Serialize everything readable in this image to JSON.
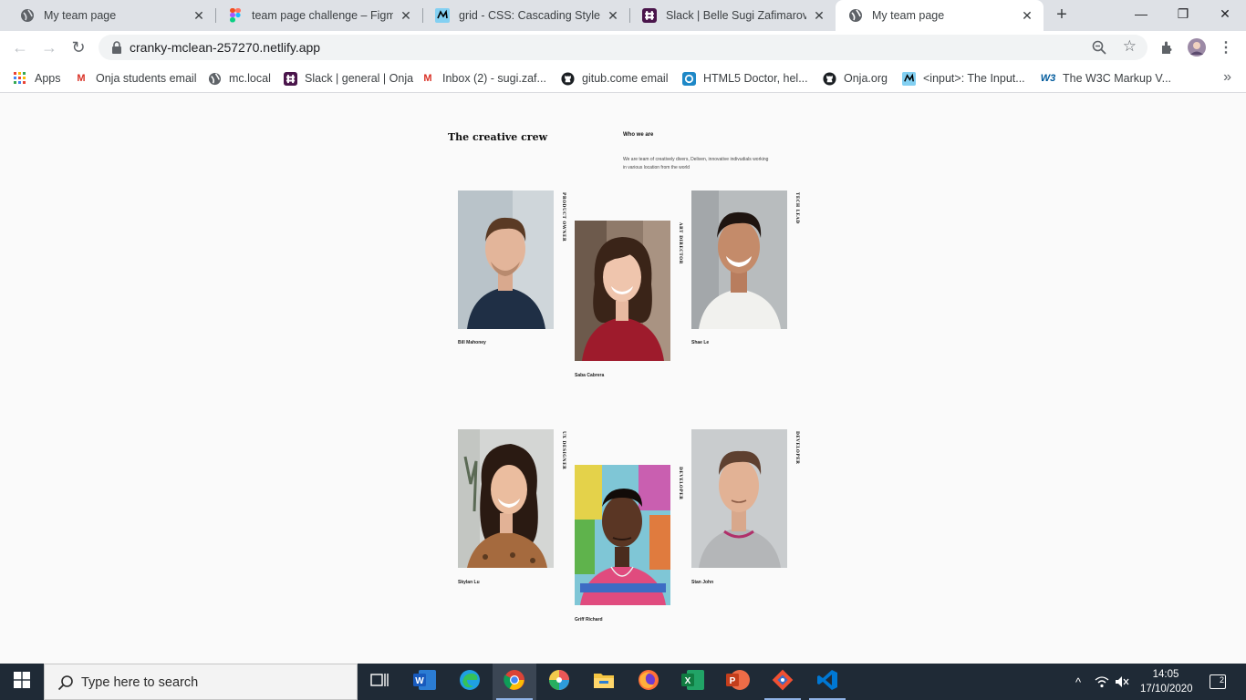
{
  "browser": {
    "tabs": [
      {
        "title": "My team page",
        "icon": "globe-icon",
        "active": false
      },
      {
        "title": "team page challenge – Figma",
        "icon": "figma-icon",
        "active": false
      },
      {
        "title": "grid - CSS: Cascading Style She",
        "icon": "mdn-icon",
        "active": false
      },
      {
        "title": "Slack | Belle Sugi Zafimarovolo",
        "icon": "slack-icon",
        "active": false
      },
      {
        "title": "My team page",
        "icon": "globe-icon",
        "active": true
      }
    ],
    "new_tab": "+",
    "window_controls": {
      "minimize": "—",
      "maximize": "❐",
      "close": "✕"
    },
    "url": "cranky-mclean-257270.netlify.app",
    "bookmarks": [
      {
        "label": "Apps",
        "icon": "apps-grid-icon"
      },
      {
        "label": "Onja students email",
        "icon": "gmail-icon"
      },
      {
        "label": "mc.local",
        "icon": "globe-icon"
      },
      {
        "label": "Slack | general | Onja",
        "icon": "slack-icon"
      },
      {
        "label": "Inbox (2) - sugi.zaf...",
        "icon": "gmail-icon"
      },
      {
        "label": "gitub.come email",
        "icon": "github-icon"
      },
      {
        "label": "HTML5 Doctor, hel...",
        "icon": "html5doctor-icon"
      },
      {
        "label": "Onja.org",
        "icon": "github-icon"
      },
      {
        "label": "<input>: The Input...",
        "icon": "mdn-icon"
      },
      {
        "label": "The W3C Markup V...",
        "icon": "w3c-icon"
      }
    ],
    "bookmarks_more": "»"
  },
  "page": {
    "title": "The creative crew",
    "who_title": "Who we are",
    "who_text": "We are team of creatively divers, Deliven, innovative indivudials working in various location from the world",
    "members": [
      {
        "name": "Bill Mahoney",
        "role": "PRODUCT OWNER"
      },
      {
        "name": "Saba Cabrera",
        "role": "ART DIRECTOR"
      },
      {
        "name": "Shae Le",
        "role": "TECH LEAD"
      },
      {
        "name": "Skylan Lu",
        "role": "UX DESIGNER"
      },
      {
        "name": "Griff Richard",
        "role": "DEVELOPER"
      },
      {
        "name": "Stan John",
        "role": "DEVELOPER"
      }
    ]
  },
  "taskbar": {
    "search_placeholder": "Type here to search",
    "apps": [
      "task-view-icon",
      "word-icon",
      "edge-icon",
      "chrome-icon",
      "paint-icon",
      "file-explorer-icon",
      "firefox-icon",
      "excel-icon",
      "powerpoint-icon",
      "git-icon",
      "vscode-icon"
    ],
    "time": "14:05",
    "date": "17/10/2020",
    "notifications": "2"
  }
}
